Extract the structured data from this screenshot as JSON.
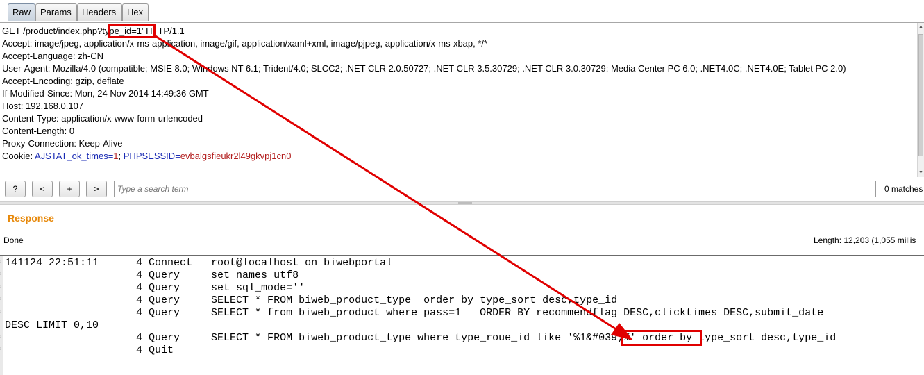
{
  "tabs": [
    "Raw",
    "Params",
    "Headers",
    "Hex"
  ],
  "request": {
    "method_path": "GET /product/index.php?",
    "param": "type_id=1'",
    "protocol": " HTTP/1.1",
    "headers": [
      "Accept: image/jpeg, application/x-ms-application, image/gif, application/xaml+xml, image/pjpeg, application/x-ms-xbap, */*",
      "Accept-Language: zh-CN",
      "User-Agent: Mozilla/4.0 (compatible; MSIE 8.0; Windows NT 6.1; Trident/4.0; SLCC2; .NET CLR 2.0.50727; .NET CLR 3.5.30729; .NET CLR 3.0.30729; Media Center PC 6.0; .NET4.0C; .NET4.0E; Tablet PC 2.0)",
      "Accept-Encoding: gzip, deflate",
      "If-Modified-Since: Mon, 24 Nov 2014 14:49:36 GMT",
      "Host: 192.168.0.107",
      "Content-Type: application/x-www-form-urlencoded",
      "Content-Length: 0",
      "Proxy-Connection: Keep-Alive"
    ],
    "cookie": {
      "label": "Cookie: ",
      "name1": "AJSTAT_ok_times",
      "eq1": "=",
      "val1": "1",
      "sep": "; ",
      "name2": "PHPSESSID",
      "eq2": "=",
      "val2": "evbalgsfieukr2l49gkvpj1cn0"
    }
  },
  "search": {
    "help_label": "?",
    "prev_label": "<",
    "add_label": "+",
    "next_label": ">",
    "placeholder": "Type a search term",
    "matches": "0 matches"
  },
  "response": {
    "title": "Response",
    "status": "Done",
    "length": "Length: 12,203 (1,055 millis"
  },
  "log": {
    "lines": [
      "141124 22:51:11      4 Connect   root@localhost on biwebportal",
      "                     4 Query     set names utf8",
      "                     4 Query     set sql_mode=''",
      "                     4 Query     SELECT * FROM biweb_product_type  order by type_sort desc,type_id",
      "                     4 Query     SELECT * from biweb_product where pass=1   ORDER BY recommendflag DESC,clicktimes DESC,submit_date",
      "DESC LIMIT 0,10",
      "                     4 Query     SELECT * FROM biweb_product_type where type_roue_id like '%1&#039;%' order by type_sort desc,type_id",
      "                     4 Quit"
    ]
  },
  "colors": {
    "highlight": "#e00000",
    "response_title": "#e7890b",
    "cookie_name": "#1a2bb4",
    "cookie_value": "#b21d1d"
  }
}
